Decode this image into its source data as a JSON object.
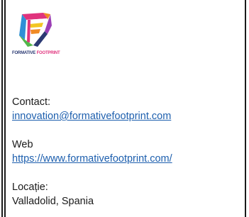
{
  "brand": {
    "logo_word_1": "FORMATIVE",
    "logo_word_2": "FOOTPRINT",
    "logo_icon": "formative-footprint-logo-icon",
    "colors": {
      "navy": "#2b3a73",
      "magenta": "#e0337d",
      "orange": "#f08a24",
      "green": "#52b64a",
      "blue": "#2f8fd6",
      "yellow": "#f3c623"
    }
  },
  "contact": {
    "label": "Contact:",
    "email": "innovation@formativefootprint.com"
  },
  "web": {
    "label": "Web",
    "url": "https://www.formativefootprint.com/"
  },
  "location": {
    "label": "Locație:",
    "value": "Valladolid, Spania"
  },
  "theme": {
    "text_color": "#1a1a1a",
    "link_color": "#1d5fae",
    "border_color": "#1a1a1a"
  }
}
